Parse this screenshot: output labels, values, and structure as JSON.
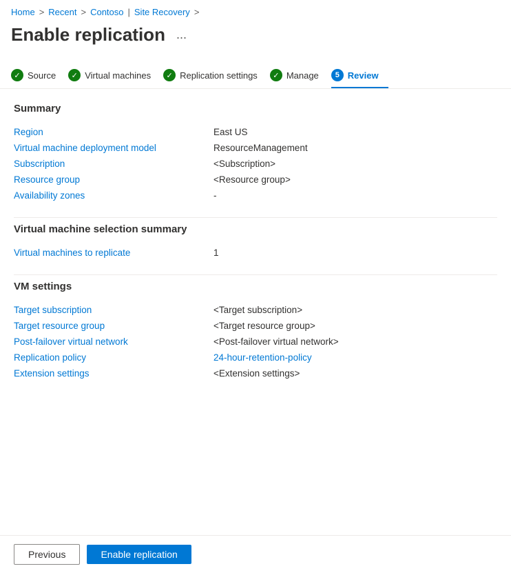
{
  "breadcrumb": {
    "home": "Home",
    "recent": "Recent",
    "contoso": "Contoso",
    "site_recovery": "Site Recovery",
    "sep": ">"
  },
  "page": {
    "title": "Enable replication",
    "ellipsis": "..."
  },
  "steps": [
    {
      "id": "source",
      "label": "Source",
      "state": "done"
    },
    {
      "id": "virtual-machines",
      "label": "Virtual machines",
      "state": "done"
    },
    {
      "id": "replication-settings",
      "label": "Replication settings",
      "state": "done"
    },
    {
      "id": "manage",
      "label": "Manage",
      "state": "done"
    },
    {
      "id": "review",
      "label": "Review",
      "state": "active",
      "number": "5"
    }
  ],
  "summary_section": {
    "heading": "Summary",
    "rows": [
      {
        "label": "Region",
        "value": "East US"
      },
      {
        "label": "Virtual machine deployment model",
        "value": "ResourceManagement"
      },
      {
        "label": "Subscription",
        "value": "<Subscription>"
      },
      {
        "label": "Resource group",
        "value": "<Resource group>"
      },
      {
        "label": "Availability zones",
        "value": "-"
      }
    ]
  },
  "vm_selection_section": {
    "heading": "Virtual machine selection summary",
    "rows": [
      {
        "label": "Virtual machines to replicate",
        "value": "1"
      }
    ]
  },
  "vm_settings_section": {
    "heading": "VM settings",
    "rows": [
      {
        "label": "Target subscription",
        "value": "<Target subscription>",
        "link": false
      },
      {
        "label": "Target resource group",
        "value": "<Target resource group>",
        "link": false
      },
      {
        "label": "Post-failover virtual network",
        "value": "<Post-failover virtual network>",
        "link": false
      },
      {
        "label": "Replication policy",
        "value": "24-hour-retention-policy",
        "link": true
      },
      {
        "label": "Extension settings",
        "value": "<Extension settings>",
        "link": false
      }
    ]
  },
  "footer": {
    "previous_label": "Previous",
    "enable_label": "Enable replication"
  }
}
